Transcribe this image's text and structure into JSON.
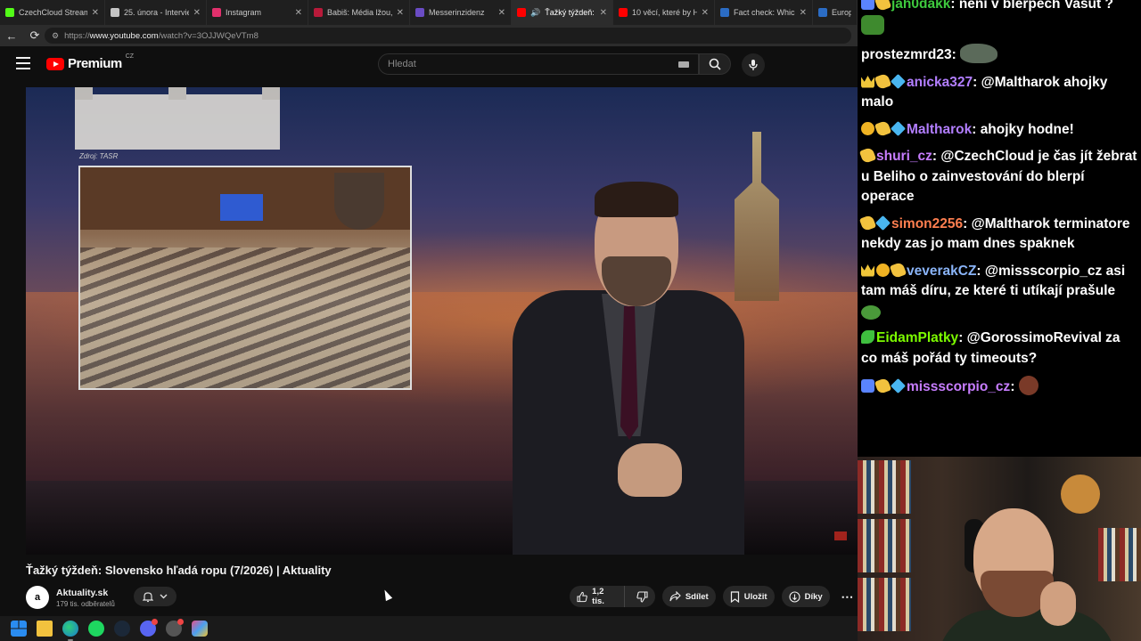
{
  "browser": {
    "tabs": [
      {
        "label": "CzechCloud Stream -",
        "color": "#53fc18",
        "active": false
      },
      {
        "label": "25. února - Intervie",
        "color": "#c4c4c4",
        "active": false
      },
      {
        "label": "Instagram",
        "color": "#e1306c",
        "active": false
      },
      {
        "label": "Babiš: Média lžou, o",
        "color": "#b81a3a",
        "active": false
      },
      {
        "label": "Messerinzidenz",
        "color": "#6a4cc4",
        "active": false
      },
      {
        "label": "Ťažký týždeň: Slo",
        "color": "#ff0000",
        "active": true
      },
      {
        "label": "10 věcí, které by Hitl",
        "color": "#ff0000",
        "active": false
      },
      {
        "label": "Fact check: Which co",
        "color": "#2b6cc4",
        "active": false
      },
      {
        "label": "Europe C",
        "color": "#2b6cc4",
        "active": false
      }
    ],
    "url_prefix": "https://",
    "url_host": "www.youtube.com",
    "url_path": "/watch?v=3OJJWQeVTm8"
  },
  "youtube": {
    "logo_text": "Premium",
    "logo_region": "CZ",
    "search_placeholder": "Hledat"
  },
  "video": {
    "inset_source": "Zdroj: TASR",
    "title": "Ťažký týždeň: Slovensko hľadá ropu (7/2026) | Aktuality",
    "channel_avatar": "a",
    "channel_name": "Aktuality.sk",
    "subscribers": "179 tis. odběratelů",
    "likes": "1,2 tis.",
    "share_label": "Sdílet",
    "save_label": "Uložit",
    "thanks_label": "Díky"
  },
  "chat": {
    "messages": [
      {
        "badges": [
          "arrow",
          "gold"
        ],
        "user": "jah0dakk",
        "color": "#3ec93e",
        "text": "není v blerpech Vašut ?",
        "emote": "frog"
      },
      {
        "badges": [],
        "user": "prostezmrd23",
        "color": "#ffffff",
        "text": "",
        "emote": "rock"
      },
      {
        "badges": [
          "crown",
          "gold",
          "cube"
        ],
        "user": "anicka327",
        "color": "#b27eff",
        "text": "@Maltharok ahojky malo",
        "emote": ""
      },
      {
        "badges": [
          "coin",
          "gold",
          "cube"
        ],
        "user": "Maltharok",
        "color": "#b27eff",
        "text": "ahojky hodne!",
        "emote": ""
      },
      {
        "badges": [
          "gold"
        ],
        "user": "shuri_cz",
        "color": "#c77dff",
        "text": "@CzechCloud je čas jít žebrat u Beliho o zainvestování do blerpí operace",
        "emote": ""
      },
      {
        "badges": [
          "gold",
          "cube"
        ],
        "user": "simon2256",
        "color": "#ff7f50",
        "text": "@Maltharok terminatore nekdy zas jo mam dnes spaknek",
        "emote": ""
      },
      {
        "badges": [
          "crown",
          "coin",
          "gold"
        ],
        "user": "veverakCZ",
        "color": "#8ab4f8",
        "text": "@missscorpio_cz asi tam máš díru, ze které ti utíkají prašule",
        "emote": "pepe"
      },
      {
        "badges": [
          "green"
        ],
        "user": "EidamPlatky",
        "color": "#7cfc00",
        "text": "@GorossimoRevival za co máš pořád ty timeouts?",
        "emote": ""
      },
      {
        "badges": [
          "arrow",
          "gold",
          "cube"
        ],
        "user": "missscorpio_cz",
        "color": "#c77dff",
        "text": "",
        "emote": "face"
      }
    ]
  }
}
